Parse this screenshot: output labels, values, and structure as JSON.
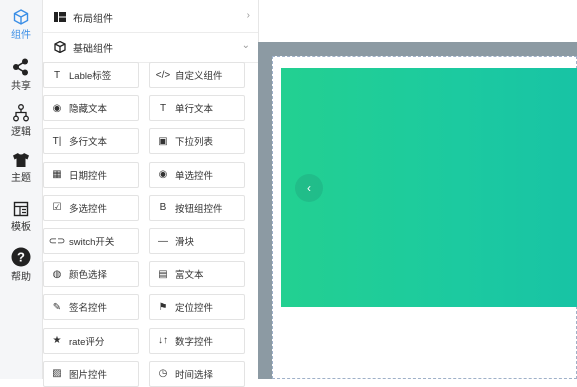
{
  "nav": [
    {
      "label": "组件",
      "icon": "cube-icon"
    },
    {
      "label": "共享",
      "icon": "share-icon"
    },
    {
      "label": "逻辑",
      "icon": "logic-icon"
    },
    {
      "label": "主题",
      "icon": "shirt-icon"
    },
    {
      "label": "模板",
      "icon": "template-icon"
    },
    {
      "label": "帮助",
      "icon": "help-icon"
    }
  ],
  "groups": {
    "layout": {
      "title": "布局组件",
      "chevron": "›"
    },
    "basic": {
      "title": "基础组件",
      "chevron": "⌄"
    }
  },
  "components": [
    {
      "label": "Lable标签",
      "icon": "T"
    },
    {
      "label": "自定义组件",
      "icon": "</>"
    },
    {
      "label": "隐藏文本",
      "icon": "◉"
    },
    {
      "label": "单行文本",
      "icon": "T"
    },
    {
      "label": "多行文本",
      "icon": "T|"
    },
    {
      "label": "下拉列表",
      "icon": "▣"
    },
    {
      "label": "日期控件",
      "icon": "▦"
    },
    {
      "label": "单选控件",
      "icon": "◉"
    },
    {
      "label": "多选控件",
      "icon": "☑"
    },
    {
      "label": "按钮组控件",
      "icon": "B"
    },
    {
      "label": "switch开关",
      "icon": "⊂⊃"
    },
    {
      "label": "滑块",
      "icon": "—"
    },
    {
      "label": "颜色选择",
      "icon": "◍"
    },
    {
      "label": "富文本",
      "icon": "▤"
    },
    {
      "label": "签名控件",
      "icon": "✎"
    },
    {
      "label": "定位控件",
      "icon": "⚑"
    },
    {
      "label": "rate评分",
      "icon": "★"
    },
    {
      "label": "数字控件",
      "icon": "↓↑"
    },
    {
      "label": "图片控件",
      "icon": "▨"
    },
    {
      "label": "时间选择",
      "icon": "◷"
    }
  ],
  "canvas": {
    "carousel_prev": "‹",
    "colors": {
      "accent": "#3a8ee6",
      "carousel_from": "#23d091",
      "carousel_to": "#18c3a5",
      "canvas_bg": "#8c9aa3"
    }
  }
}
